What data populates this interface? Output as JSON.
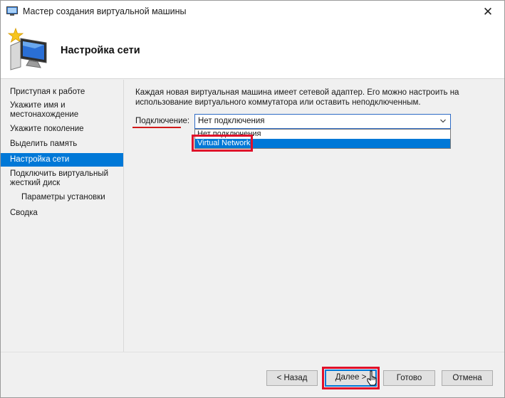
{
  "window": {
    "title": "Мастер создания виртуальной машины",
    "close_glyph": "✕"
  },
  "header": {
    "title": "Настройка сети",
    "icon": "virtual-machine-wizard-icon"
  },
  "sidebar": {
    "items": [
      {
        "label": "Приступая к работе"
      },
      {
        "label": "Укажите имя и местонахождение"
      },
      {
        "label": "Укажите поколение"
      },
      {
        "label": "Выделить память"
      },
      {
        "label": "Настройка сети",
        "active": true
      },
      {
        "label": "Подключить виртуальный жесткий диск"
      },
      {
        "label": "Параметры установки",
        "sub": true
      },
      {
        "label": "Сводка"
      }
    ]
  },
  "content": {
    "description": "Каждая новая виртуальная машина имеет сетевой адаптер. Его можно настроить на использование виртуального коммутатора или оставить неподключенным.",
    "connection_label": "Подключение:",
    "connection_value": "Нет подключения",
    "options": [
      "Нет подключения",
      "Virtual Network"
    ],
    "highlighted_option": "Virtual Network"
  },
  "footer": {
    "back": "< Назад",
    "next": "Далее >",
    "finish": "Готово",
    "cancel": "Отмена"
  },
  "colors": {
    "accent": "#0078d7",
    "annotation": "#e0102a"
  }
}
